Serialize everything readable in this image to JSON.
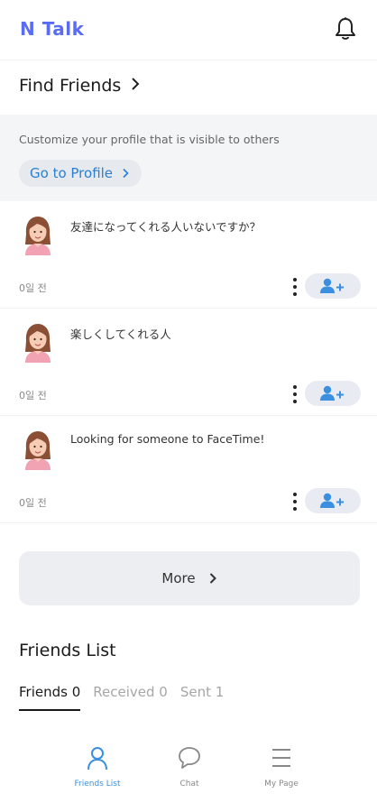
{
  "header": {
    "logo": "N Talk"
  },
  "find_friends": {
    "title": "Find Friends",
    "profile_description": "Customize your profile that is visible to others",
    "go_to_profile_label": "Go to Profile"
  },
  "posts": [
    {
      "text": "友達になってくれる人いないですか？",
      "date": "0일 전"
    },
    {
      "text": "楽しくしてくれる人",
      "date": "0일 전"
    },
    {
      "text": "Looking for someone to FaceTime!",
      "date": "0일 전"
    }
  ],
  "more_label": "More",
  "friends_list": {
    "title": "Friends List",
    "tabs": [
      {
        "label": "Friends 0",
        "active": true
      },
      {
        "label": "Received 0",
        "active": false
      },
      {
        "label": "Sent 1",
        "active": false
      }
    ]
  },
  "bottom_nav": [
    {
      "label": "Friends List",
      "icon": "person-icon",
      "active": true
    },
    {
      "label": "Chat",
      "icon": "chat-bubble-icon",
      "active": false
    },
    {
      "label": "My Page",
      "icon": "menu-icon",
      "active": false
    }
  ],
  "colors": {
    "brand": "#5a6cf5",
    "accent_blue": "#3a8fe0",
    "add_button_bg": "#e8ecf2"
  }
}
